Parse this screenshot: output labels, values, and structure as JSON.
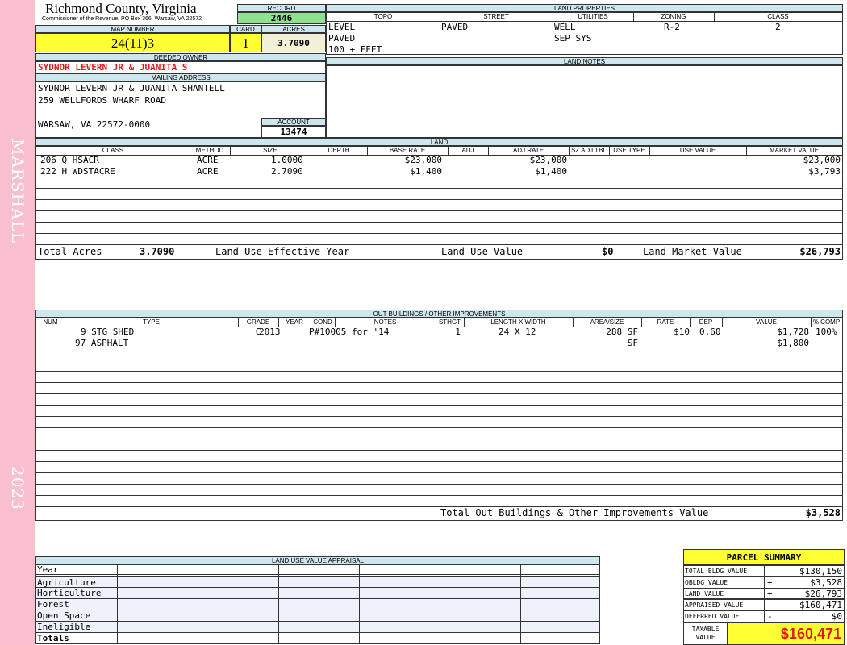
{
  "sidebar": {
    "neighborhood": "MARSHALL",
    "year": "2023"
  },
  "header": {
    "county": "Richmond County, Virginia",
    "commissioner": "Commissioner of the Revenue, PO Box 366, Warsaw, VA 22572",
    "record_label": "RECORD",
    "record": "2446",
    "map_number_label": "MAP NUMBER",
    "map_number": "24(11)3",
    "card_label": "CARD",
    "card": "1",
    "acres_label": "ACRES",
    "acres": "3.7090"
  },
  "land_properties": {
    "title": "LAND PROPERTIES",
    "columns": [
      "TOPO",
      "STREET",
      "UTILITIES",
      "ZONING",
      "CLASS"
    ],
    "topo": [
      "LEVEL",
      "PAVED",
      "100 + FEET"
    ],
    "street": [
      "PAVED"
    ],
    "utilities": [
      "WELL",
      "SEP SYS"
    ],
    "zoning": "R-2",
    "class": "2"
  },
  "owner": {
    "deeded_label": "DEEDED OWNER",
    "deeded_owner": "SYDNOR LEVERN JR & JUANITA S",
    "mailing_label": "MAILING ADDRESS",
    "mailing_lines": [
      "SYDNOR LEVERN JR & JUANITA SHANTELL",
      "259 WELLFORDS WHARF ROAD",
      "",
      "WARSAW, VA 22572-0000"
    ],
    "account_label": "ACCOUNT",
    "account": "13474"
  },
  "land_notes": {
    "title": "LAND NOTES"
  },
  "land": {
    "title": "LAND",
    "columns": [
      "CLASS",
      "METHOD",
      "SIZE",
      "DEPTH",
      "BASE RATE",
      "ADJ",
      "ADJ RATE",
      "SZ ADJ TBL",
      "USE TYPE",
      "USE VALUE",
      "MARKET VALUE"
    ],
    "rows": [
      {
        "class": "206 Q HSACR",
        "method": "ACRE",
        "size": "1.0000",
        "base_rate": "$23,000",
        "adj_rate": "$23,000",
        "market_value": "$23,000"
      },
      {
        "class": "222 H WDSTACRE",
        "method": "ACRE",
        "size": "2.7090",
        "base_rate": "$1,400",
        "adj_rate": "$1,400",
        "market_value": "$3,793"
      }
    ],
    "totals": {
      "acres_label": "Total Acres",
      "acres": "3.7090",
      "effective_year_label": "Land Use Effective Year",
      "use_value_label": "Land Use Value",
      "use_value": "$0",
      "market_value_label": "Land Market Value",
      "market_value": "$26,793"
    }
  },
  "outbuildings": {
    "title": "OUT BUILDINGS / OTHER IMPROVEMENTS",
    "columns": [
      "NUM",
      "TYPE",
      "GRADE",
      "YEAR",
      "COND",
      "NOTES",
      "STHGT",
      "LENGTH X WIDTH",
      "AREA/SIZE",
      "RATE",
      "DEP",
      "VALUE",
      "% COMP"
    ],
    "rows": [
      {
        "type": "9 STG SHED",
        "grade": "C",
        "year": "2013",
        "notes": "P#10005 for '14",
        "sthgt": "1",
        "lxw": "24 X 12",
        "area": "288 SF",
        "rate": "$10",
        "dep": "0.60",
        "value": "$1,728",
        "comp": "100%"
      },
      {
        "type": "97 ASPHALT",
        "grade": "",
        "year": "",
        "notes": "",
        "sthgt": "",
        "lxw": "",
        "area": "SF",
        "rate": "",
        "dep": "",
        "value": "$1,800",
        "comp": ""
      }
    ],
    "total_label": "Total Out Buildings & Other Improvements Value",
    "total": "$3,528"
  },
  "land_use": {
    "title": "LAND USE VALUE APPRAISAL",
    "rows": [
      "Year",
      "Agriculture",
      "Horticulture",
      "Forest",
      "Open Space",
      "Ineligible",
      "Totals"
    ]
  },
  "summary": {
    "title": "PARCEL SUMMARY",
    "rows": [
      {
        "label": "TOTAL BLDG VALUE",
        "op": "",
        "value": "$130,150"
      },
      {
        "label": "OBLDG VALUE",
        "op": "+",
        "value": "$3,528"
      },
      {
        "label": "LAND VALUE",
        "op": "+",
        "value": "$26,793"
      },
      {
        "label": "APPRAISED VALUE",
        "op": "",
        "value": "$160,471"
      },
      {
        "label": "DEFERRED VALUE",
        "op": "-",
        "value": "$0"
      }
    ],
    "taxable_label_1": "TAXABLE",
    "taxable_label_2": "VALUE",
    "taxable": "$160,471"
  }
}
